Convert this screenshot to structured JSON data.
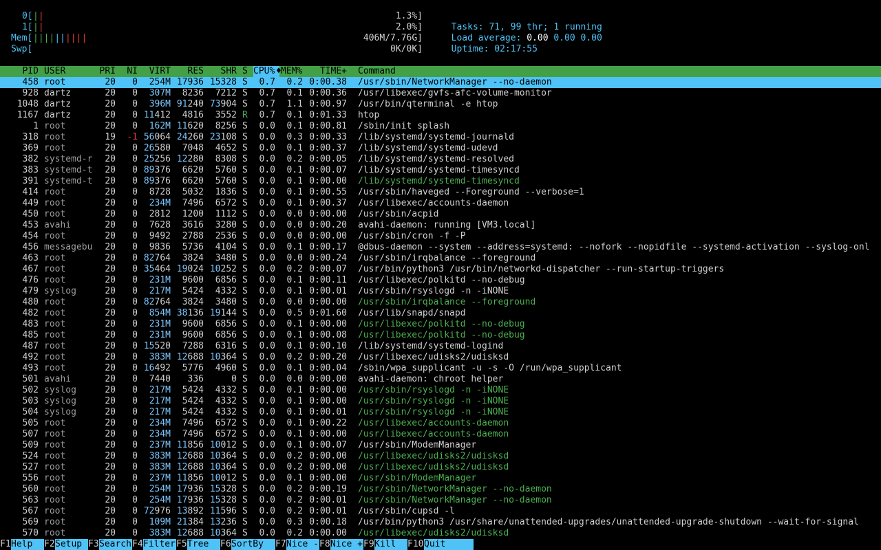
{
  "meters": {
    "cpu0": {
      "label": "0[",
      "bars": "||",
      "pct": "1.3%]"
    },
    "cpu1": {
      "label": "1[",
      "bars": "||",
      "pct": "2.0%]"
    },
    "mem": {
      "label": "Mem[",
      "bars": "||||||||||",
      "value": "406M/7.76G]"
    },
    "swp": {
      "label": "Swp[",
      "value": "0K/0K]"
    }
  },
  "info": {
    "tasks_label": "Tasks: ",
    "tasks_val": "71, 99 thr; 1 running",
    "load_label": "Load average: ",
    "load_1": "0.00",
    "load_5": "0.00",
    "load_15": "0.00",
    "uptime_label": "Uptime: ",
    "uptime_val": "02:17:55"
  },
  "columns": {
    "pid": "PID",
    "user": "USER",
    "pri": "PRI",
    "ni": "NI",
    "virt": "VIRT",
    "res": "RES",
    "shr": "SHR",
    "s": "S",
    "cpu": "CPU%",
    "mem": "MEM%",
    "time": "TIME+",
    "cmd": "Command"
  },
  "rows": [
    {
      "pid": "458",
      "user": "root",
      "pri": "20",
      "ni": "0",
      "virt": "254M",
      "res": "17936",
      "shr": "15328",
      "s": "S",
      "cpu": "0.7",
      "mem": "0.2",
      "time": "0:00.38",
      "cmd": "/usr/sbin/NetworkManager --no-daemon",
      "thread": false,
      "selected": true
    },
    {
      "pid": "928",
      "user": "dartz",
      "pri": "20",
      "ni": "0",
      "virt": "307M",
      "res": "8236",
      "shr": "7212",
      "s": "S",
      "cpu": "0.7",
      "mem": "0.1",
      "time": "0:00.36",
      "cmd": "/usr/libexec/gvfs-afc-volume-monitor",
      "thread": false
    },
    {
      "pid": "1048",
      "user": "dartz",
      "pri": "20",
      "ni": "0",
      "virt": "396M",
      "res": "91240",
      "shr": "73904",
      "s": "S",
      "cpu": "0.7",
      "mem": "1.1",
      "time": "0:00.97",
      "cmd": "/usr/bin/qterminal -e htop",
      "thread": false
    },
    {
      "pid": "1167",
      "user": "dartz",
      "pri": "20",
      "ni": "0",
      "virt": "11412",
      "res": "4816",
      "shr": "3552",
      "s": "R",
      "cpu": "0.7",
      "mem": "0.1",
      "time": "0:01.33",
      "cmd": "htop",
      "thread": false
    },
    {
      "pid": "1",
      "user": "root",
      "pri": "20",
      "ni": "0",
      "virt": "162M",
      "res": "11620",
      "shr": "8256",
      "s": "S",
      "cpu": "0.0",
      "mem": "0.1",
      "time": "0:00.81",
      "cmd": "/sbin/init splash",
      "thread": false
    },
    {
      "pid": "318",
      "user": "root",
      "pri": "19",
      "ni": "-1",
      "virt": "56064",
      "res": "24260",
      "shr": "23108",
      "s": "S",
      "cpu": "0.0",
      "mem": "0.3",
      "time": "0:00.33",
      "cmd": "/lib/systemd/systemd-journald",
      "thread": false
    },
    {
      "pid": "369",
      "user": "root",
      "pri": "20",
      "ni": "0",
      "virt": "26580",
      "res": "7048",
      "shr": "4652",
      "s": "S",
      "cpu": "0.0",
      "mem": "0.1",
      "time": "0:00.37",
      "cmd": "/lib/systemd/systemd-udevd",
      "thread": false
    },
    {
      "pid": "382",
      "user": "systemd-r",
      "pri": "20",
      "ni": "0",
      "virt": "25256",
      "res": "12280",
      "shr": "8308",
      "s": "S",
      "cpu": "0.0",
      "mem": "0.2",
      "time": "0:00.05",
      "cmd": "/lib/systemd/systemd-resolved",
      "thread": false
    },
    {
      "pid": "383",
      "user": "systemd-t",
      "pri": "20",
      "ni": "0",
      "virt": "89376",
      "res": "6620",
      "shr": "5760",
      "s": "S",
      "cpu": "0.0",
      "mem": "0.1",
      "time": "0:00.07",
      "cmd": "/lib/systemd/systemd-timesyncd",
      "thread": false
    },
    {
      "pid": "391",
      "user": "systemd-t",
      "pri": "20",
      "ni": "0",
      "virt": "89376",
      "res": "6620",
      "shr": "5760",
      "s": "S",
      "cpu": "0.0",
      "mem": "0.1",
      "time": "0:00.00",
      "cmd": "/lib/systemd/systemd-timesyncd",
      "thread": true
    },
    {
      "pid": "414",
      "user": "root",
      "pri": "20",
      "ni": "0",
      "virt": "8728",
      "res": "5032",
      "shr": "1836",
      "s": "S",
      "cpu": "0.0",
      "mem": "0.1",
      "time": "0:00.55",
      "cmd": "/usr/sbin/haveged --Foreground --verbose=1",
      "thread": false
    },
    {
      "pid": "449",
      "user": "root",
      "pri": "20",
      "ni": "0",
      "virt": "234M",
      "res": "7496",
      "shr": "6572",
      "s": "S",
      "cpu": "0.0",
      "mem": "0.1",
      "time": "0:00.37",
      "cmd": "/usr/libexec/accounts-daemon",
      "thread": false
    },
    {
      "pid": "450",
      "user": "root",
      "pri": "20",
      "ni": "0",
      "virt": "2812",
      "res": "1200",
      "shr": "1112",
      "s": "S",
      "cpu": "0.0",
      "mem": "0.0",
      "time": "0:00.00",
      "cmd": "/usr/sbin/acpid",
      "thread": false
    },
    {
      "pid": "453",
      "user": "avahi",
      "pri": "20",
      "ni": "0",
      "virt": "7628",
      "res": "3616",
      "shr": "3280",
      "s": "S",
      "cpu": "0.0",
      "mem": "0.0",
      "time": "0:00.20",
      "cmd": "avahi-daemon: running [VM3.local]",
      "thread": false
    },
    {
      "pid": "454",
      "user": "root",
      "pri": "20",
      "ni": "0",
      "virt": "9492",
      "res": "2788",
      "shr": "2536",
      "s": "S",
      "cpu": "0.0",
      "mem": "0.0",
      "time": "0:00.00",
      "cmd": "/usr/sbin/cron -f -P",
      "thread": false
    },
    {
      "pid": "456",
      "user": "messagebu",
      "pri": "20",
      "ni": "0",
      "virt": "9836",
      "res": "5736",
      "shr": "4104",
      "s": "S",
      "cpu": "0.0",
      "mem": "0.1",
      "time": "0:00.17",
      "cmd": "@dbus-daemon --system --address=systemd: --nofork --nopidfile --systemd-activation --syslog-onl",
      "thread": false
    },
    {
      "pid": "463",
      "user": "root",
      "pri": "20",
      "ni": "0",
      "virt": "82764",
      "res": "3824",
      "shr": "3480",
      "s": "S",
      "cpu": "0.0",
      "mem": "0.0",
      "time": "0:00.24",
      "cmd": "/usr/sbin/irqbalance --foreground",
      "thread": false
    },
    {
      "pid": "467",
      "user": "root",
      "pri": "20",
      "ni": "0",
      "virt": "35464",
      "res": "19024",
      "shr": "10252",
      "s": "S",
      "cpu": "0.0",
      "mem": "0.2",
      "time": "0:00.07",
      "cmd": "/usr/bin/python3 /usr/bin/networkd-dispatcher --run-startup-triggers",
      "thread": false
    },
    {
      "pid": "476",
      "user": "root",
      "pri": "20",
      "ni": "0",
      "virt": "231M",
      "res": "9600",
      "shr": "6856",
      "s": "S",
      "cpu": "0.0",
      "mem": "0.1",
      "time": "0:00.11",
      "cmd": "/usr/libexec/polkitd --no-debug",
      "thread": false
    },
    {
      "pid": "479",
      "user": "syslog",
      "pri": "20",
      "ni": "0",
      "virt": "217M",
      "res": "5424",
      "shr": "4332",
      "s": "S",
      "cpu": "0.0",
      "mem": "0.1",
      "time": "0:00.01",
      "cmd": "/usr/sbin/rsyslogd -n -iNONE",
      "thread": false
    },
    {
      "pid": "480",
      "user": "root",
      "pri": "20",
      "ni": "0",
      "virt": "82764",
      "res": "3824",
      "shr": "3480",
      "s": "S",
      "cpu": "0.0",
      "mem": "0.0",
      "time": "0:00.00",
      "cmd": "/usr/sbin/irqbalance --foreground",
      "thread": true
    },
    {
      "pid": "482",
      "user": "root",
      "pri": "20",
      "ni": "0",
      "virt": "854M",
      "res": "38136",
      "shr": "19144",
      "s": "S",
      "cpu": "0.0",
      "mem": "0.5",
      "time": "0:01.60",
      "cmd": "/usr/lib/snapd/snapd",
      "thread": false
    },
    {
      "pid": "483",
      "user": "root",
      "pri": "20",
      "ni": "0",
      "virt": "231M",
      "res": "9600",
      "shr": "6856",
      "s": "S",
      "cpu": "0.0",
      "mem": "0.1",
      "time": "0:00.00",
      "cmd": "/usr/libexec/polkitd --no-debug",
      "thread": true
    },
    {
      "pid": "485",
      "user": "root",
      "pri": "20",
      "ni": "0",
      "virt": "231M",
      "res": "9600",
      "shr": "6856",
      "s": "S",
      "cpu": "0.0",
      "mem": "0.1",
      "time": "0:00.08",
      "cmd": "/usr/libexec/polkitd --no-debug",
      "thread": true
    },
    {
      "pid": "487",
      "user": "root",
      "pri": "20",
      "ni": "0",
      "virt": "15520",
      "res": "7288",
      "shr": "6316",
      "s": "S",
      "cpu": "0.0",
      "mem": "0.1",
      "time": "0:00.10",
      "cmd": "/lib/systemd/systemd-logind",
      "thread": false
    },
    {
      "pid": "492",
      "user": "root",
      "pri": "20",
      "ni": "0",
      "virt": "383M",
      "res": "12688",
      "shr": "10364",
      "s": "S",
      "cpu": "0.0",
      "mem": "0.2",
      "time": "0:00.20",
      "cmd": "/usr/libexec/udisks2/udisksd",
      "thread": false
    },
    {
      "pid": "493",
      "user": "root",
      "pri": "20",
      "ni": "0",
      "virt": "16492",
      "res": "5776",
      "shr": "4960",
      "s": "S",
      "cpu": "0.0",
      "mem": "0.1",
      "time": "0:00.04",
      "cmd": "/sbin/wpa_supplicant -u -s -O /run/wpa_supplicant",
      "thread": false
    },
    {
      "pid": "501",
      "user": "avahi",
      "pri": "20",
      "ni": "0",
      "virt": "7440",
      "res": "336",
      "shr": "0",
      "s": "S",
      "cpu": "0.0",
      "mem": "0.0",
      "time": "0:00.00",
      "cmd": "avahi-daemon: chroot helper",
      "thread": false
    },
    {
      "pid": "502",
      "user": "syslog",
      "pri": "20",
      "ni": "0",
      "virt": "217M",
      "res": "5424",
      "shr": "4332",
      "s": "S",
      "cpu": "0.0",
      "mem": "0.1",
      "time": "0:00.00",
      "cmd": "/usr/sbin/rsyslogd -n -iNONE",
      "thread": true
    },
    {
      "pid": "503",
      "user": "syslog",
      "pri": "20",
      "ni": "0",
      "virt": "217M",
      "res": "5424",
      "shr": "4332",
      "s": "S",
      "cpu": "0.0",
      "mem": "0.1",
      "time": "0:00.00",
      "cmd": "/usr/sbin/rsyslogd -n -iNONE",
      "thread": true
    },
    {
      "pid": "504",
      "user": "syslog",
      "pri": "20",
      "ni": "0",
      "virt": "217M",
      "res": "5424",
      "shr": "4332",
      "s": "S",
      "cpu": "0.0",
      "mem": "0.1",
      "time": "0:00.01",
      "cmd": "/usr/sbin/rsyslogd -n -iNONE",
      "thread": true
    },
    {
      "pid": "505",
      "user": "root",
      "pri": "20",
      "ni": "0",
      "virt": "234M",
      "res": "7496",
      "shr": "6572",
      "s": "S",
      "cpu": "0.0",
      "mem": "0.1",
      "time": "0:00.22",
      "cmd": "/usr/libexec/accounts-daemon",
      "thread": true
    },
    {
      "pid": "507",
      "user": "root",
      "pri": "20",
      "ni": "0",
      "virt": "234M",
      "res": "7496",
      "shr": "6572",
      "s": "S",
      "cpu": "0.0",
      "mem": "0.1",
      "time": "0:00.00",
      "cmd": "/usr/libexec/accounts-daemon",
      "thread": true
    },
    {
      "pid": "509",
      "user": "root",
      "pri": "20",
      "ni": "0",
      "virt": "237M",
      "res": "11856",
      "shr": "10012",
      "s": "S",
      "cpu": "0.0",
      "mem": "0.1",
      "time": "0:00.07",
      "cmd": "/usr/sbin/ModemManager",
      "thread": false
    },
    {
      "pid": "524",
      "user": "root",
      "pri": "20",
      "ni": "0",
      "virt": "383M",
      "res": "12688",
      "shr": "10364",
      "s": "S",
      "cpu": "0.0",
      "mem": "0.2",
      "time": "0:00.00",
      "cmd": "/usr/libexec/udisks2/udisksd",
      "thread": true
    },
    {
      "pid": "527",
      "user": "root",
      "pri": "20",
      "ni": "0",
      "virt": "383M",
      "res": "12688",
      "shr": "10364",
      "s": "S",
      "cpu": "0.0",
      "mem": "0.2",
      "time": "0:00.00",
      "cmd": "/usr/libexec/udisks2/udisksd",
      "thread": true
    },
    {
      "pid": "556",
      "user": "root",
      "pri": "20",
      "ni": "0",
      "virt": "237M",
      "res": "11856",
      "shr": "10012",
      "s": "S",
      "cpu": "0.0",
      "mem": "0.1",
      "time": "0:00.00",
      "cmd": "/usr/sbin/ModemManager",
      "thread": true
    },
    {
      "pid": "560",
      "user": "root",
      "pri": "20",
      "ni": "0",
      "virt": "254M",
      "res": "17936",
      "shr": "15328",
      "s": "S",
      "cpu": "0.0",
      "mem": "0.2",
      "time": "0:00.19",
      "cmd": "/usr/sbin/NetworkManager --no-daemon",
      "thread": true
    },
    {
      "pid": "563",
      "user": "root",
      "pri": "20",
      "ni": "0",
      "virt": "254M",
      "res": "17936",
      "shr": "15328",
      "s": "S",
      "cpu": "0.0",
      "mem": "0.2",
      "time": "0:00.01",
      "cmd": "/usr/sbin/NetworkManager --no-daemon",
      "thread": true
    },
    {
      "pid": "567",
      "user": "root",
      "pri": "20",
      "ni": "0",
      "virt": "72976",
      "res": "13892",
      "shr": "11596",
      "s": "S",
      "cpu": "0.0",
      "mem": "0.2",
      "time": "0:00.01",
      "cmd": "/usr/sbin/cupsd -l",
      "thread": false
    },
    {
      "pid": "569",
      "user": "root",
      "pri": "20",
      "ni": "0",
      "virt": "109M",
      "res": "21384",
      "shr": "13236",
      "s": "S",
      "cpu": "0.0",
      "mem": "0.3",
      "time": "0:00.18",
      "cmd": "/usr/bin/python3 /usr/share/unattended-upgrades/unattended-upgrade-shutdown --wait-for-signal",
      "thread": false
    },
    {
      "pid": "570",
      "user": "root",
      "pri": "20",
      "ni": "0",
      "virt": "383M",
      "res": "12688",
      "shr": "10364",
      "s": "S",
      "cpu": "0.0",
      "mem": "0.2",
      "time": "0:00.00",
      "cmd": "/usr/libexec/udisks2/udisksd",
      "thread": true
    }
  ],
  "function_keys": [
    {
      "key": "F1",
      "label": "Help"
    },
    {
      "key": "F2",
      "label": "Setup"
    },
    {
      "key": "F3",
      "label": "Search"
    },
    {
      "key": "F4",
      "label": "Filter"
    },
    {
      "key": "F5",
      "label": "Tree"
    },
    {
      "key": "F6",
      "label": "SortBy"
    },
    {
      "key": "F7",
      "label": "Nice -"
    },
    {
      "key": "F8",
      "label": "Nice +"
    },
    {
      "key": "F9",
      "label": "Kill"
    },
    {
      "key": "F10",
      "label": "Quit"
    }
  ],
  "colors": {
    "header_bg": "#43a047",
    "selected_bg": "#4fc3f7",
    "thread_cmd": "#4caf50",
    "accent": "#4fc3f7"
  }
}
